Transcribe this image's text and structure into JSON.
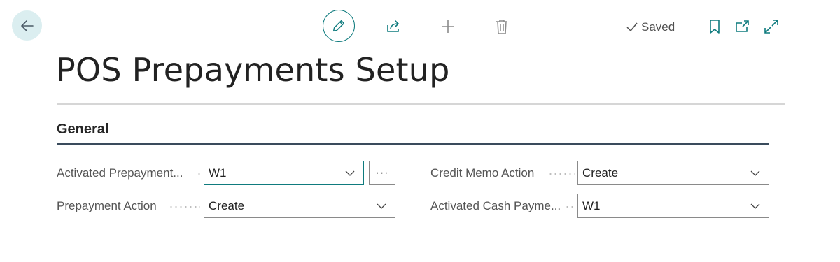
{
  "page": {
    "title": "POS Prepayments Setup",
    "status": "Saved"
  },
  "icons": {
    "back": "arrow-left-icon",
    "edit": "pencil-icon",
    "share": "share-icon",
    "new": "plus-icon",
    "delete": "trash-icon",
    "saved": "checkmark-icon",
    "bookmark": "bookmark-icon",
    "popout": "open-in-new-window-icon",
    "expand": "expand-icon",
    "dropdown": "chevron-down-icon",
    "lookup": "ellipsis-icon"
  },
  "colors": {
    "accent": "#0f7b7e",
    "back_bg": "#dbeef0"
  },
  "section": {
    "title": "General"
  },
  "fields": {
    "activated_prepayment": {
      "label": "Activated Prepayment...",
      "value": "W1",
      "lookup": "···"
    },
    "prepayment_action": {
      "label": "Prepayment Action",
      "value": "Create"
    },
    "credit_memo_action": {
      "label": "Credit Memo Action",
      "value": "Create"
    },
    "activated_cash_payment": {
      "label": "Activated Cash Payme...",
      "value": "W1"
    }
  }
}
